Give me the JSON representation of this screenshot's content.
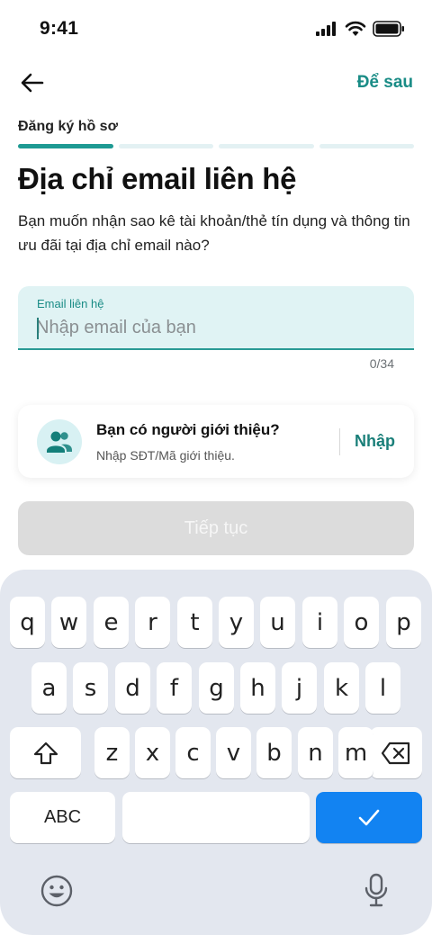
{
  "status_bar": {
    "time": "9:41"
  },
  "header": {
    "later_label": "Để sau"
  },
  "progress": {
    "label": "Đăng ký hồ sơ",
    "total_steps": 4,
    "current_step": 1
  },
  "page": {
    "title": "Địa chỉ email liên hệ",
    "description": "Bạn muốn nhận sao kê tài khoản/thẻ tín dụng và thông tin ưu đãi tại địa chỉ email nào?"
  },
  "email_field": {
    "label": "Email liên hệ",
    "placeholder": "Nhập email của bạn",
    "value": "",
    "counter": "0/34"
  },
  "referral": {
    "title": "Bạn có người giới thiệu?",
    "subtitle": "Nhập SĐT/Mã giới thiệu.",
    "action_label": "Nhập"
  },
  "continue_label": "Tiếp tục",
  "keyboard": {
    "row1": [
      "q",
      "w",
      "e",
      "r",
      "t",
      "y",
      "u",
      "i",
      "o",
      "p"
    ],
    "row2": [
      "a",
      "s",
      "d",
      "f",
      "g",
      "h",
      "j",
      "k",
      "l"
    ],
    "row3": [
      "z",
      "x",
      "c",
      "v",
      "b",
      "n",
      "m"
    ],
    "abc_label": "ABC",
    "done_color": "#1283f2"
  },
  "colors": {
    "accent": "#1a8c86",
    "field_bg": "#e0f3f4",
    "keyboard_bg": "#e3e7ef"
  }
}
